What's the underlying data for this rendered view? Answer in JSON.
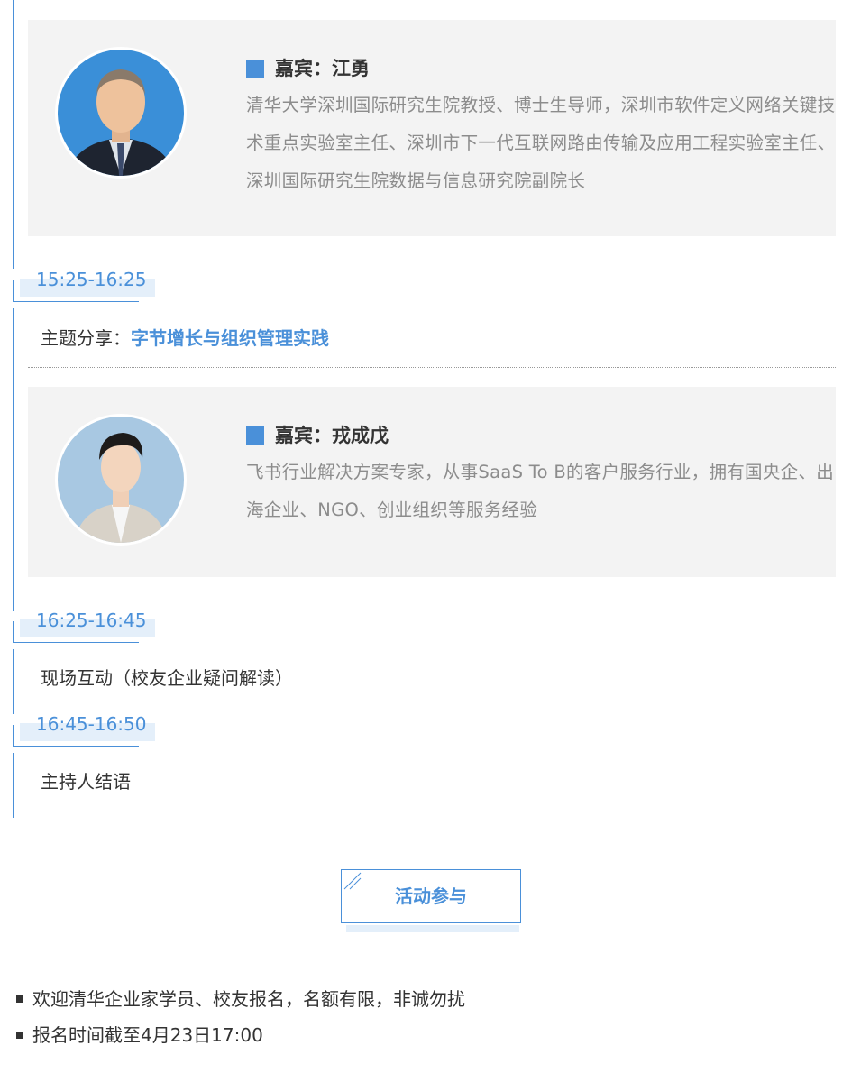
{
  "guest1": {
    "title": "嘉宾：江勇",
    "desc": "清华大学深圳国际研究生院教授、博士生导师，深圳市软件定义网络关键技术重点实验室主任、深圳市下一代互联网路由传输及应用工程实验室主任、深圳国际研究生院数据与信息研究院副院长"
  },
  "agenda": [
    {
      "time": "15:25-16:25",
      "prefix": "主题分享：",
      "topic": "字节增长与组织管理实践"
    },
    {
      "time": "16:25-16:45",
      "text": "现场互动（校友企业疑问解读）"
    },
    {
      "time": "16:45-16:50",
      "text": "主持人结语"
    }
  ],
  "guest2": {
    "title": "嘉宾：戎成戊",
    "desc": "飞书行业解决方案专家，从事SaaS To B的客户服务行业，拥有国央企、出海企业、NGO、创业组织等服务经验"
  },
  "join_button": "活动参与",
  "notes": [
    "欢迎清华企业家学员、校友报名，名额有限，非诚勿扰",
    "报名时间截至4月23日17:00"
  ],
  "colors": {
    "accent": "#4a90d9",
    "card_bg": "#f3f3f3",
    "desc_text": "#8c8c8c"
  }
}
